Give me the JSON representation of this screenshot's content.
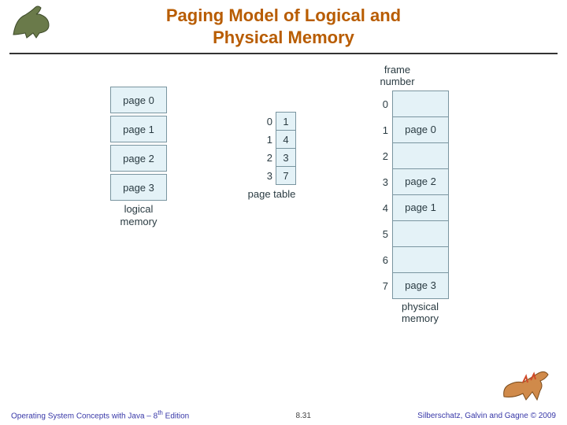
{
  "title_line1": "Paging Model of Logical and",
  "title_line2": "Physical Memory",
  "logical_memory": {
    "label": "logical\nmemory",
    "pages": [
      "page 0",
      "page 1",
      "page 2",
      "page 3"
    ]
  },
  "page_table": {
    "label": "page table",
    "entries": [
      {
        "index": "0",
        "frame": "1"
      },
      {
        "index": "1",
        "frame": "4"
      },
      {
        "index": "2",
        "frame": "3"
      },
      {
        "index": "3",
        "frame": "7"
      }
    ]
  },
  "physical_memory": {
    "header": "frame\nnumber",
    "label": "physical\nmemory",
    "frames": [
      {
        "index": "0",
        "content": ""
      },
      {
        "index": "1",
        "content": "page 0"
      },
      {
        "index": "2",
        "content": ""
      },
      {
        "index": "3",
        "content": "page 2"
      },
      {
        "index": "4",
        "content": "page 1"
      },
      {
        "index": "5",
        "content": ""
      },
      {
        "index": "6",
        "content": ""
      },
      {
        "index": "7",
        "content": "page 3"
      }
    ]
  },
  "footer": {
    "book_prefix": "Operating System Concepts with Java – 8",
    "book_sup": "th",
    "book_suffix": " Edition",
    "page": "8.31",
    "copyright": "Silberschatz, Galvin and Gagne © 2009"
  }
}
